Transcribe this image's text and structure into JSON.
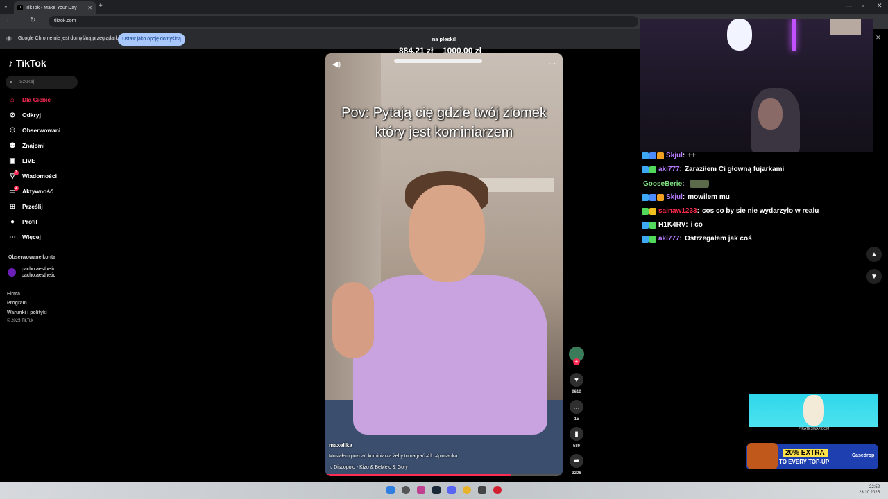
{
  "browser": {
    "tab_title": "TikTok - Make Your Day",
    "url": "tiktok.com",
    "notification_text": "Google Chrome nie jest domyślną przeglądarką",
    "notification_button": "Ustaw jako opcję domyślną"
  },
  "sidebar": {
    "logo": "TikTok",
    "search_placeholder": "Szukaj",
    "items": [
      {
        "label": "Dla Ciebie",
        "icon": "home-icon",
        "badge": ""
      },
      {
        "label": "Odkryj",
        "icon": "compass-icon",
        "badge": ""
      },
      {
        "label": "Obserwowani",
        "icon": "user-check-icon",
        "badge": ""
      },
      {
        "label": "Znajomi",
        "icon": "users-icon",
        "badge": ""
      },
      {
        "label": "LIVE",
        "icon": "live-icon",
        "badge": ""
      },
      {
        "label": "Wiadomości",
        "icon": "message-icon",
        "badge": "3"
      },
      {
        "label": "Aktywność",
        "icon": "activity-icon",
        "badge": "2"
      },
      {
        "label": "Prześlij",
        "icon": "upload-icon",
        "badge": ""
      },
      {
        "label": "Profil",
        "icon": "profile-icon",
        "badge": ""
      },
      {
        "label": "Więcej",
        "icon": "more-icon",
        "badge": ""
      }
    ],
    "followed_title": "Obserwowane konta",
    "followed_account": {
      "name": "pacho.aesthetic",
      "handle": "pacho.aesthetic"
    },
    "footer": [
      "Firma",
      "Program",
      "Warunki i polityki",
      "© 2025 TikTok"
    ]
  },
  "goal": {
    "title": "na pleski!",
    "current": "884,21 zł",
    "target": "1000,00 zł"
  },
  "video": {
    "caption": "Pov: Pytają cię gdzie twój ziomek który jest kominiarzem",
    "author": "maxellka",
    "description": "Musiałem poznać kominiarza żeby to nagrać #dc #piosanka",
    "music": "Discopolo - Kizo & BeMelo & Gory",
    "likes": "9610",
    "comments": "15",
    "saves": "580",
    "shares": "3206"
  },
  "chat": [
    {
      "user": "Skjul",
      "color": "#b77bff",
      "text": "++",
      "badges": [
        "#3da9f5",
        "#4a8cff",
        "#f0a020"
      ]
    },
    {
      "user": "aki777",
      "color": "#b77bff",
      "text": "Zaraziłem Ci głowną fujarkami",
      "badges": [
        "#3da9f5",
        "#52d85a"
      ]
    },
    {
      "user": "GooseBerie",
      "color": "#7fe07f",
      "text": "",
      "badges": []
    },
    {
      "user": "Skjul",
      "color": "#b77bff",
      "text": "mowilem mu",
      "badges": [
        "#3da9f5",
        "#4a8cff",
        "#f0a020"
      ]
    },
    {
      "user": "sainaw1233",
      "color": "#ff2a4a",
      "text": "cos co by sie nie wydarzylo w realu",
      "badges": [
        "#52d85a",
        "#f0c020"
      ]
    },
    {
      "user": "H1K4RV",
      "color": "#ffffff",
      "text": "i co",
      "badges": [
        "#3da9f5",
        "#52d85a"
      ]
    },
    {
      "user": "aki777",
      "color": "#b77bff",
      "text": "Ostrzegałem jak coś",
      "badges": [
        "#3da9f5",
        "#52d85a"
      ]
    }
  ],
  "ads": {
    "ad1_label": "PIRATESWAP.COM",
    "ad2_pct": "20% EXTRA",
    "ad2_sub": "TO EVERY TOP-UP",
    "ad2_brand": "Casedrop"
  },
  "taskbar": {
    "time": "22:52",
    "date": "23.10.2025"
  },
  "colors": {
    "accent": "#fe2c55",
    "background": "#000000"
  }
}
